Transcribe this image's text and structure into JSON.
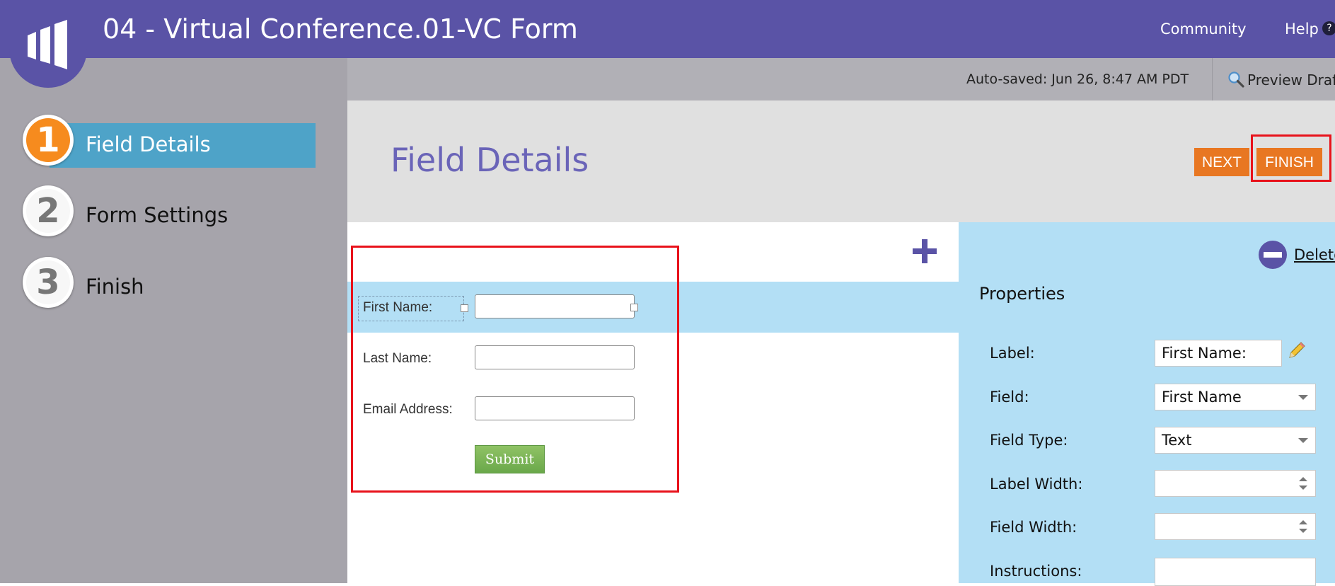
{
  "header": {
    "title": "04 - Virtual Conference.01-VC Form",
    "community_label": "Community",
    "help_label": "Help",
    "help_icon_glyph": "?"
  },
  "steps": [
    {
      "number": "1",
      "label": "Field Details",
      "active": true
    },
    {
      "number": "2",
      "label": "Form Settings",
      "active": false
    },
    {
      "number": "3",
      "label": "Finish",
      "active": false
    }
  ],
  "subheader": {
    "autosave_text": "Auto-saved: Jun 26, 8:47 AM PDT",
    "preview_label": "Preview Draft"
  },
  "page": {
    "title": "Field Details",
    "next_label": "NEXT",
    "finish_label": "FINISH"
  },
  "form": {
    "fields": [
      {
        "label": "First Name:",
        "value": ""
      },
      {
        "label": "Last Name:",
        "value": ""
      },
      {
        "label": "Email Address:",
        "value": ""
      }
    ],
    "submit_label": "Submit"
  },
  "properties": {
    "title": "Properties",
    "delete_label": "Delete",
    "rows": [
      {
        "label": "Label:",
        "value": "First Name:"
      },
      {
        "label": "Field:",
        "value": "First Name"
      },
      {
        "label": "Field Type:",
        "value": "Text"
      },
      {
        "label": "Label Width:",
        "value": ""
      },
      {
        "label": "Field Width:",
        "value": ""
      },
      {
        "label": "Instructions:",
        "value": ""
      }
    ]
  },
  "colors": {
    "brand_purple": "#5a53a6",
    "accent_orange": "#e87722",
    "step_active_blue": "#4ea3c8",
    "selection_blue": "#b3dff5",
    "highlight_red": "#e8121b"
  },
  "icons": [
    "marketo-logo-icon",
    "help-icon",
    "magnifier-icon",
    "add-icon",
    "delete-minus-icon",
    "pencil-icon",
    "dropdown-caret-icon",
    "spinner-icon"
  ]
}
